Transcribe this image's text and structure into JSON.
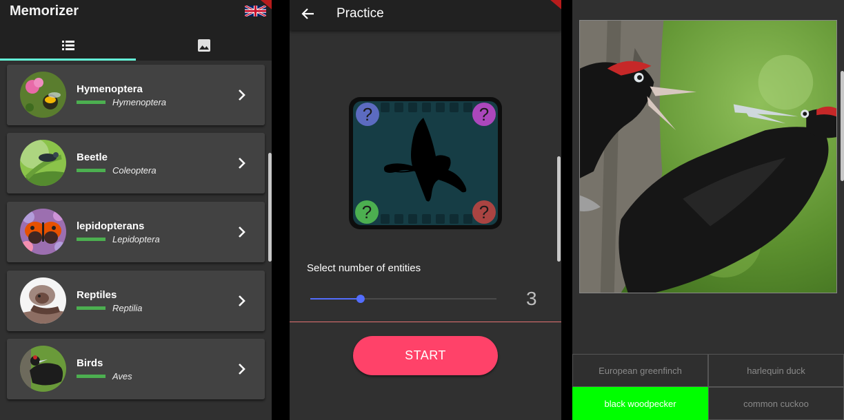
{
  "panel1": {
    "app_title": "Memorizer",
    "flag_icon": "uk-flag-icon",
    "tabs": [
      {
        "name": "list",
        "icon": "list-icon"
      },
      {
        "name": "images",
        "icon": "image-icon"
      }
    ],
    "categories": [
      {
        "name": "Hymenoptera",
        "scientific": "Hymenoptera"
      },
      {
        "name": "Beetle",
        "scientific": "Coleoptera"
      },
      {
        "name": "lepidopterans",
        "scientific": "Lepidoptera"
      },
      {
        "name": "Reptiles",
        "scientific": "Reptilia"
      },
      {
        "name": "Birds",
        "scientific": "Aves"
      }
    ]
  },
  "panel2": {
    "title": "Practice",
    "select_label": "Select number of entities",
    "slider_value": "3",
    "slider_fraction": 0.27,
    "start_label": "START"
  },
  "panel3": {
    "answers": [
      {
        "label": "European greenfinch",
        "correct": false
      },
      {
        "label": "harlequin duck",
        "correct": false
      },
      {
        "label": "black woodpecker",
        "correct": true
      },
      {
        "label": "common cuckoo",
        "correct": false
      }
    ]
  },
  "colors": {
    "accent_teal": "#64ffda",
    "progress_green": "#4caf50",
    "start_pink": "#ff4269",
    "slider_blue": "#536dfe",
    "correct_green": "#00ff00"
  }
}
